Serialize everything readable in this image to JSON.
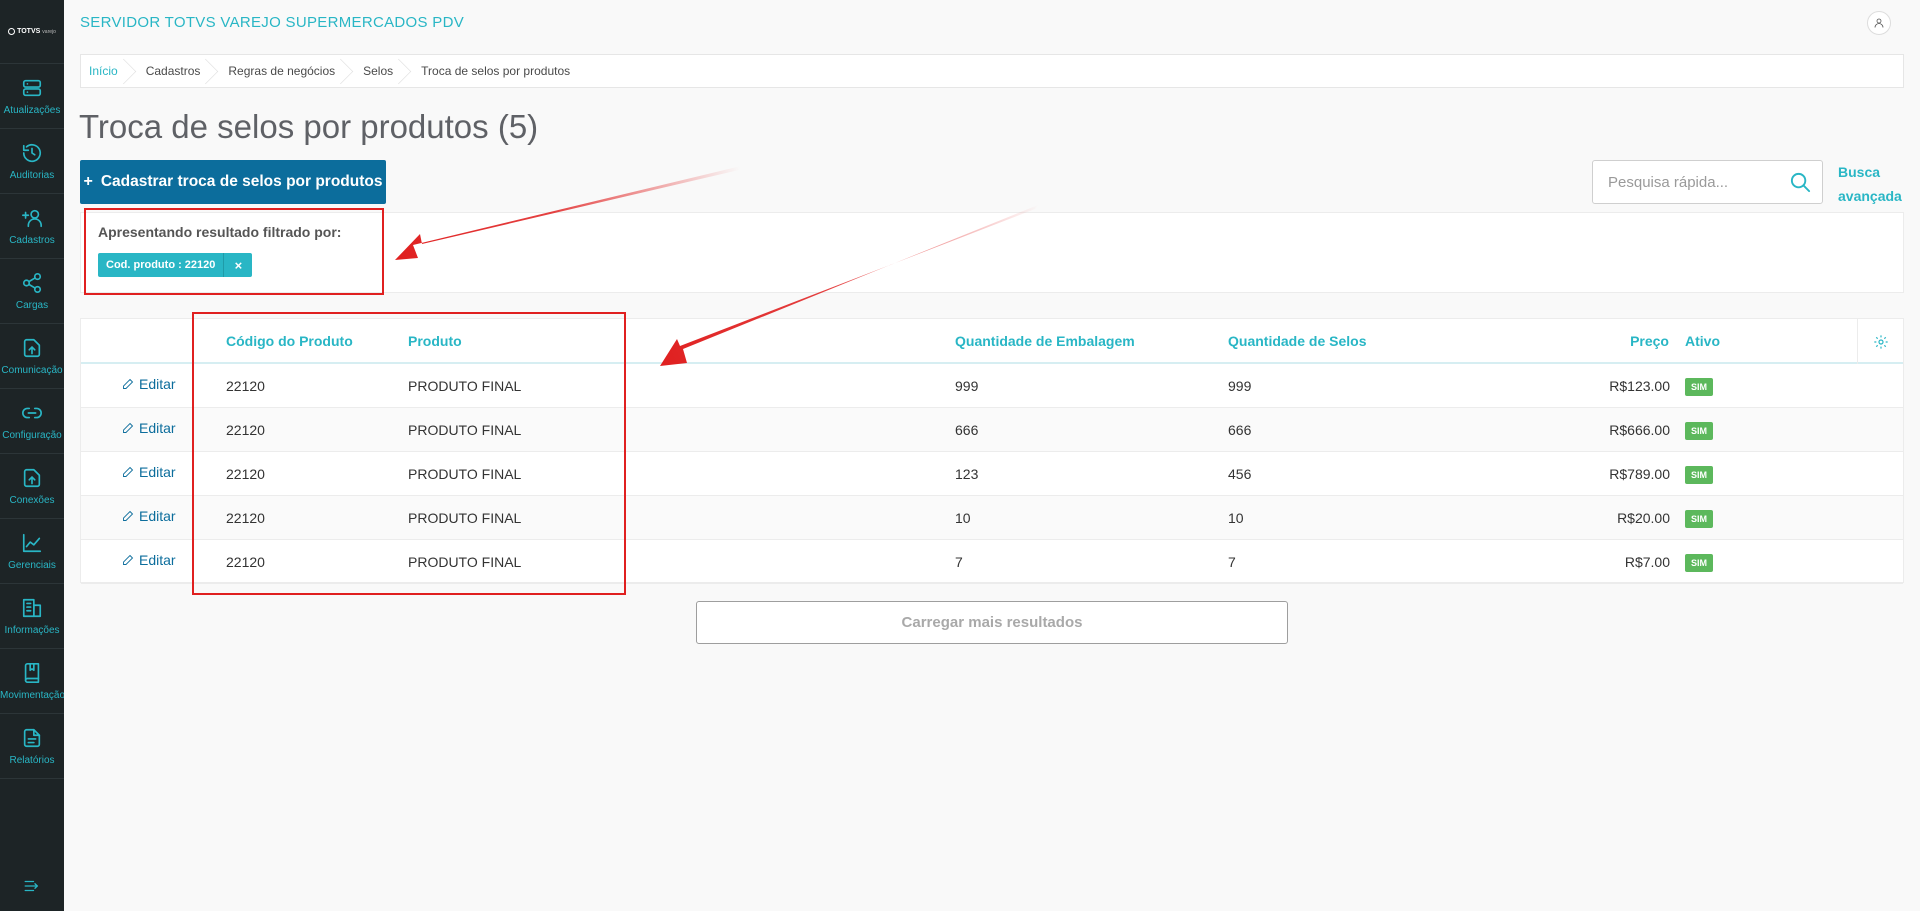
{
  "app": {
    "title": "SERVIDOR TOTVS VAREJO SUPERMERCADOS PDV",
    "logo_text": "TOTVS",
    "logo_sub": "varejo"
  },
  "sidebar": {
    "items": [
      {
        "label": "Atualizações",
        "icon": "server-icon"
      },
      {
        "label": "Auditorias",
        "icon": "history-icon"
      },
      {
        "label": "Cadastros",
        "icon": "user-plus-icon"
      },
      {
        "label": "Cargas",
        "icon": "share-icon"
      },
      {
        "label": "Comunicação",
        "icon": "file-upload-icon"
      },
      {
        "label": "Configuração",
        "icon": "link-icon"
      },
      {
        "label": "Conexões",
        "icon": "file-upload-icon"
      },
      {
        "label": "Gerenciais",
        "icon": "chart-icon"
      },
      {
        "label": "Informações",
        "icon": "building-icon"
      },
      {
        "label": "Movimentação",
        "icon": "book-icon"
      },
      {
        "label": "Relatórios",
        "icon": "document-icon"
      }
    ]
  },
  "breadcrumb": [
    "Início",
    "Cadastros",
    "Regras de negócios",
    "Selos",
    "Troca de selos por produtos"
  ],
  "page": {
    "title": "Troca de selos por produtos (5)"
  },
  "toolbar": {
    "add_plus": "+",
    "add_label": "Cadastrar troca de selos por produtos"
  },
  "search": {
    "placeholder": "Pesquisa rápida...",
    "advanced_label_1": "Busca",
    "advanced_label_2": "avançada"
  },
  "filter": {
    "label": "Apresentando resultado filtrado por:",
    "chip": "Cod. produto : 22120",
    "chip_close": "×"
  },
  "table": {
    "columns": [
      "Código do Produto",
      "Produto",
      "Quantidade de Embalagem",
      "Quantidade de Selos",
      "Preço",
      "Ativo"
    ],
    "edit_label": "Editar",
    "rows": [
      {
        "code": "22120",
        "product": "PRODUTO FINAL",
        "pack_qty": "999",
        "stamp_qty": "999",
        "price": "R$123.00",
        "active": "SIM"
      },
      {
        "code": "22120",
        "product": "PRODUTO FINAL",
        "pack_qty": "666",
        "stamp_qty": "666",
        "price": "R$666.00",
        "active": "SIM"
      },
      {
        "code": "22120",
        "product": "PRODUTO FINAL",
        "pack_qty": "123",
        "stamp_qty": "456",
        "price": "R$789.00",
        "active": "SIM"
      },
      {
        "code": "22120",
        "product": "PRODUTO FINAL",
        "pack_qty": "10",
        "stamp_qty": "10",
        "price": "R$20.00",
        "active": "SIM"
      },
      {
        "code": "22120",
        "product": "PRODUTO FINAL",
        "pack_qty": "7",
        "stamp_qty": "7",
        "price": "R$7.00",
        "active": "SIM"
      }
    ]
  },
  "load_more": {
    "label": "Carregar mais resultados"
  },
  "colors": {
    "accent": "#29b6c5",
    "primary": "#0c6d9c",
    "sidebar": "#1d2426",
    "success": "#5cb85c",
    "annotation": "#e02020"
  }
}
